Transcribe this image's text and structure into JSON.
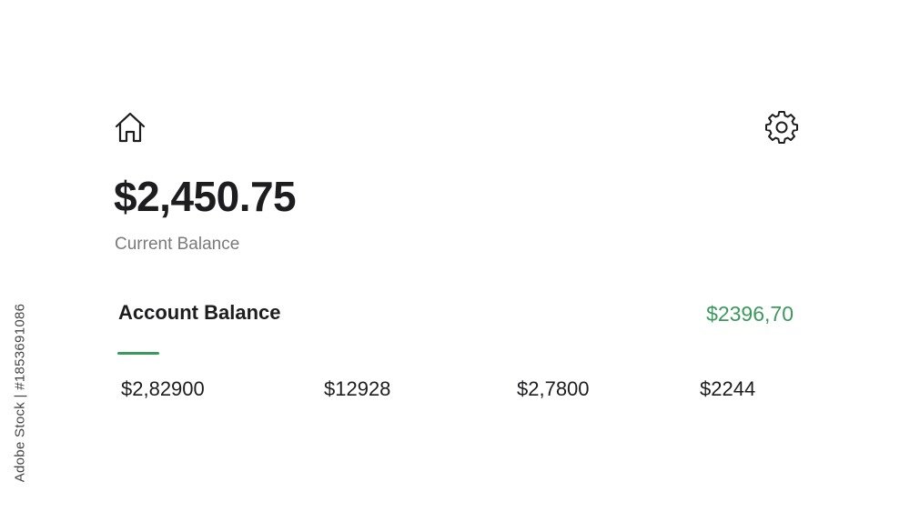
{
  "header": {
    "home_icon": "home-icon",
    "settings_icon": "gear-icon"
  },
  "balance": {
    "amount": "$2,450.75",
    "label": "Current Balance"
  },
  "account": {
    "title": "Account Balance",
    "value": "$2396,70"
  },
  "values": [
    "$2,82900",
    "$12928",
    "$2,7800",
    "$2244"
  ],
  "watermark": {
    "side_text": "Adobe Stock | #1853691086"
  },
  "colors": {
    "accent_green": "#3a9a5b",
    "text_primary": "#1d1d1f",
    "text_secondary": "#7a7a7a"
  }
}
